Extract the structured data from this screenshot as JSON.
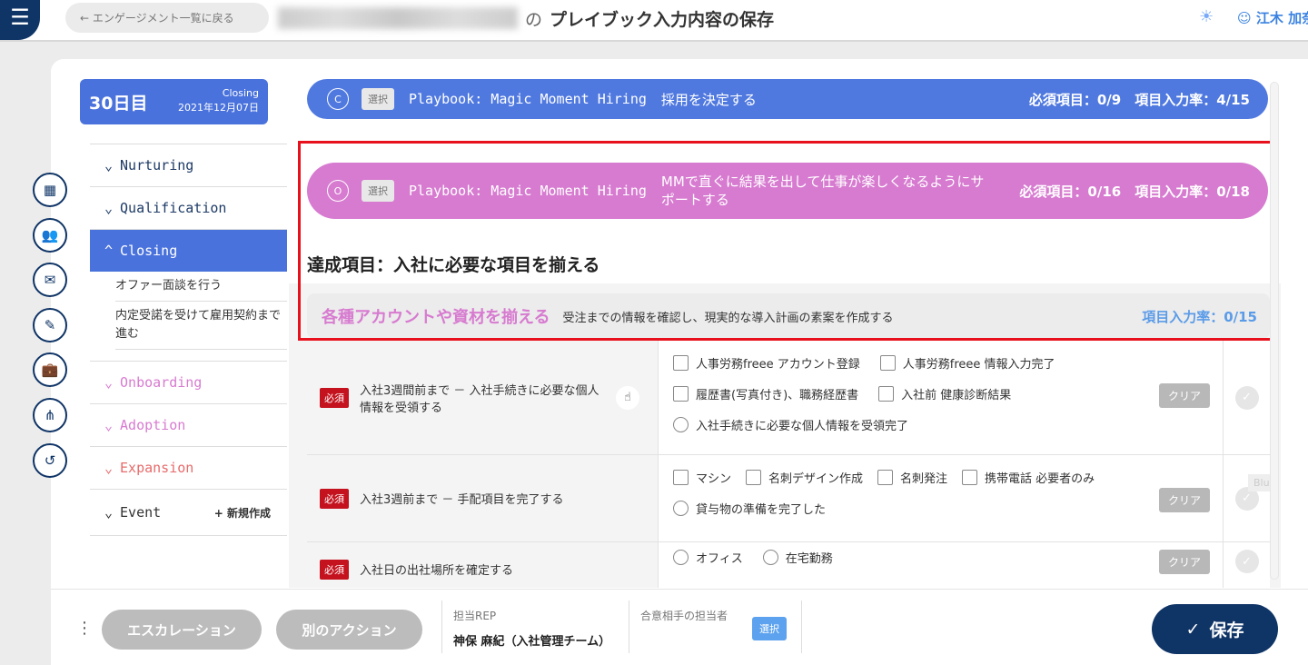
{
  "header": {
    "back_label": "← エンゲージメント一覧に戻る",
    "title_connector": "の",
    "title": "プレイブック入力内容の保存",
    "user_name": "江木 加奈"
  },
  "sidebar": {
    "day": "30日目",
    "phase": "Closing",
    "date": "2021年12月07日",
    "nav": [
      {
        "label": "Nurturing",
        "arrow": "⌄"
      },
      {
        "label": "Qualification",
        "arrow": "⌄"
      },
      {
        "label": "Closing",
        "arrow": "^"
      }
    ],
    "sub": [
      "オファー面談を行う",
      "内定受諾を受けて雇用契約まで進む"
    ],
    "nav2": [
      {
        "label": "Onboarding",
        "arrow": "⌄"
      },
      {
        "label": "Adoption",
        "arrow": "⌄"
      },
      {
        "label": "Expansion",
        "arrow": "⌄"
      },
      {
        "label": "Event",
        "arrow": "⌄"
      }
    ],
    "new_label": "+ 新規作成"
  },
  "banners": [
    {
      "badge": "C",
      "select": "選択",
      "playbook": "Playbook: Magic Moment Hiring",
      "goal": "採用を決定する",
      "stats": "必須項目：0/9　項目入力率：4/15",
      "color": "#5079e0"
    },
    {
      "badge": "O",
      "select": "選択",
      "playbook": "Playbook: Magic Moment Hiring",
      "goal": "MMで直ぐに結果を出して仕事が楽しくなるようにサポートする",
      "stats": "必須項目：0/16　項目入力率：0/18",
      "color": "#d77bd0"
    }
  ],
  "goal_title": "達成項目：入社に必要な項目を揃える",
  "section": {
    "title": "各種アカウントや資材を揃える",
    "desc": "受注までの情報を確認し、現実的な導入計画の素案を作成する",
    "rate": "項目入力率：0/15"
  },
  "rows": [
    {
      "req": "必須",
      "label": "入社3週間前まで － 入社手続きに必要な個人情報を受領する",
      "checks": [
        "人事労務freee アカウント登録",
        "人事労務freee 情報入力完了",
        "履歴書(写真付き)、職務経歴書",
        "入社前 健康診断結果"
      ],
      "radios": [
        "入社手続きに必要な個人情報を受領完了"
      ],
      "clear": "クリア"
    },
    {
      "req": "必須",
      "label": "入社3週前まで － 手配項目を完了する",
      "checks": [
        "マシン",
        "名刺デザイン作成",
        "名刺発注",
        "携帯電話 必要者のみ"
      ],
      "radios": [
        "貸与物の準備を完了した"
      ],
      "clear": "クリア"
    },
    {
      "req": "必須",
      "label": "入社日の出社場所を確定する",
      "checks": [],
      "radios": [
        "オフィス",
        "在宅勤務"
      ],
      "clear": "クリア"
    }
  ],
  "blur_tag": "Blur",
  "footer": {
    "escalation": "エスカレーション",
    "other_action": "別のアクション",
    "rep_label": "担当REP",
    "rep_value": "神保 麻紀（入社管理チーム）",
    "contact_label": "合意相手の担当者",
    "select": "選択",
    "save": "保存"
  }
}
